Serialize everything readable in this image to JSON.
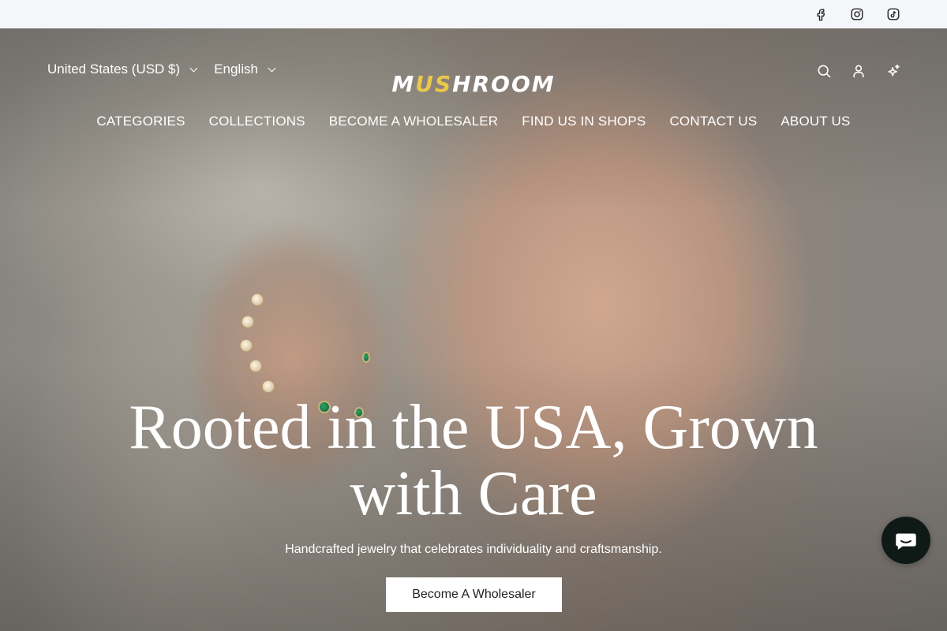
{
  "topbar": {
    "social": [
      {
        "icon": "facebook-icon"
      },
      {
        "icon": "instagram-icon"
      },
      {
        "icon": "tiktok-icon"
      }
    ]
  },
  "header": {
    "country_selector": "United States (USD $)",
    "language_selector": "English",
    "logo": {
      "text_start": "M",
      "text_accent": "US",
      "text_end": "HROOM",
      "accent_color": "#e9c84a"
    },
    "icons": [
      "search-icon",
      "account-icon",
      "sparkle-icon"
    ]
  },
  "nav": {
    "items": [
      {
        "label": "CATEGORIES"
      },
      {
        "label": "COLLECTIONS"
      },
      {
        "label": "BECOME A WHOLESALER"
      },
      {
        "label": "FIND US IN SHOPS"
      },
      {
        "label": "CONTACT US"
      },
      {
        "label": "ABOUT US"
      }
    ]
  },
  "hero": {
    "headline": "Rooted in the USA, Grown with Care",
    "subheadline": "Handcrafted jewelry that celebrates individuality and craftsmanship.",
    "cta_label": "Become A Wholesaler"
  },
  "chat": {
    "icon": "chat-icon",
    "color": "#0f1a16"
  }
}
